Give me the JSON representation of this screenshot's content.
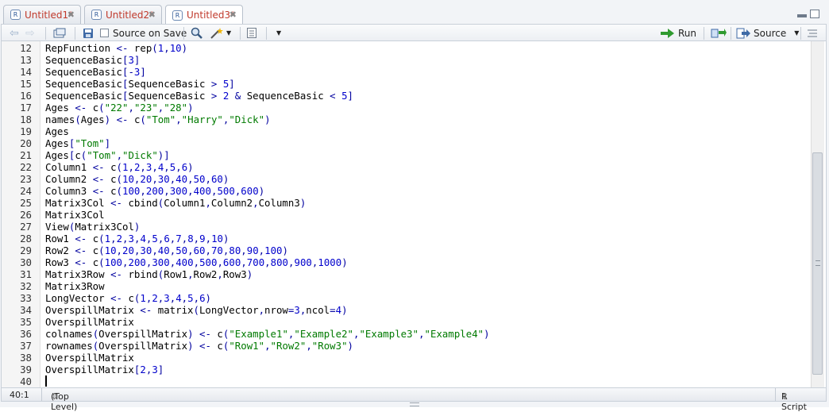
{
  "tabs": [
    {
      "label": "Untitled1*",
      "active": false
    },
    {
      "label": "Untitled2*",
      "active": false
    },
    {
      "label": "Untitled3*",
      "active": true
    }
  ],
  "toolbar": {
    "source_on_save": "Source on Save",
    "run": "Run",
    "source": "Source"
  },
  "colors": {
    "number": "#0000cc",
    "string": "#007a00",
    "operator": "#00009f",
    "tab_text": "#c0392b"
  },
  "code_lines": [
    {
      "n": "12",
      "text": "RepFunction <- rep(1,10)"
    },
    {
      "n": "13",
      "text": "SequenceBasic[3]"
    },
    {
      "n": "14",
      "text": "SequenceBasic[-3]"
    },
    {
      "n": "15",
      "text": "SequenceBasic[SequenceBasic > 5]"
    },
    {
      "n": "16",
      "text": "SequenceBasic[SequenceBasic > 2 & SequenceBasic < 5]"
    },
    {
      "n": "17",
      "text": "Ages <- c(\"22\",\"23\",\"28\")"
    },
    {
      "n": "18",
      "text": "names(Ages) <- c(\"Tom\",\"Harry\",\"Dick\")"
    },
    {
      "n": "19",
      "text": "Ages"
    },
    {
      "n": "20",
      "text": "Ages[\"Tom\"]"
    },
    {
      "n": "21",
      "text": "Ages[c(\"Tom\",\"Dick\")]"
    },
    {
      "n": "22",
      "text": "Column1 <- c(1,2,3,4,5,6)"
    },
    {
      "n": "23",
      "text": "Column2 <- c(10,20,30,40,50,60)"
    },
    {
      "n": "24",
      "text": "Column3 <- c(100,200,300,400,500,600)"
    },
    {
      "n": "25",
      "text": "Matrix3Col <- cbind(Column1,Column2,Column3)"
    },
    {
      "n": "26",
      "text": "Matrix3Col"
    },
    {
      "n": "27",
      "text": "View(Matrix3Col)"
    },
    {
      "n": "28",
      "text": "Row1 <- c(1,2,3,4,5,6,7,8,9,10)"
    },
    {
      "n": "29",
      "text": "Row2 <- c(10,20,30,40,50,60,70,80,90,100)"
    },
    {
      "n": "30",
      "text": "Row3 <- c(100,200,300,400,500,600,700,800,900,1000)"
    },
    {
      "n": "31",
      "text": "Matrix3Row <- rbind(Row1,Row2,Row3)"
    },
    {
      "n": "32",
      "text": "Matrix3Row"
    },
    {
      "n": "33",
      "text": "LongVector <- c(1,2,3,4,5,6)"
    },
    {
      "n": "34",
      "text": "OverspillMatrix <- matrix(LongVector,nrow=3,ncol=4)"
    },
    {
      "n": "35",
      "text": "OverspillMatrix"
    },
    {
      "n": "36",
      "text": "colnames(OverspillMatrix) <- c(\"Example1\",\"Example2\",\"Example3\",\"Example4\")"
    },
    {
      "n": "37",
      "text": "rownames(OverspillMatrix) <- c(\"Row1\",\"Row2\",\"Row3\")"
    },
    {
      "n": "38",
      "text": "OverspillMatrix"
    },
    {
      "n": "39",
      "text": "OverspillMatrix[2,3]"
    },
    {
      "n": "40",
      "text": ""
    }
  ],
  "status": {
    "position": "40:1",
    "scope": "(Top Level)",
    "file_type": "R Script"
  }
}
